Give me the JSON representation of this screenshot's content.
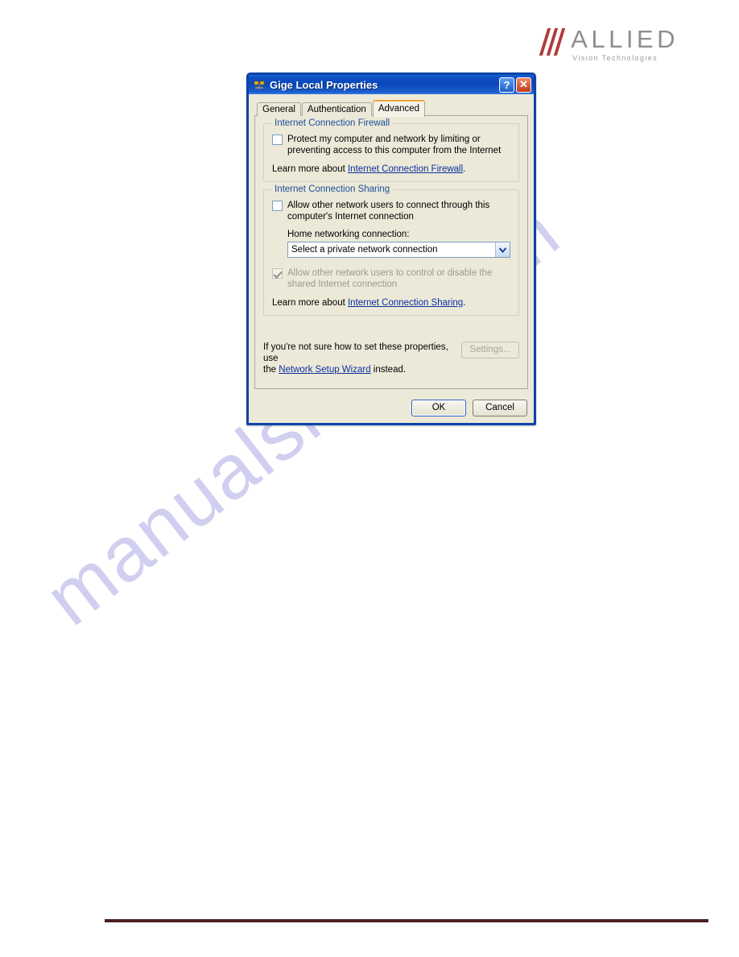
{
  "page": {
    "watermark": "manualshive.com",
    "logo": {
      "name": "ALLIED",
      "tagline": "Vision Technologies",
      "slash_color": "#b03a3a",
      "text_color": "#8d8d8d"
    },
    "footer_rule_color": "#4a1f1f"
  },
  "dialog": {
    "title": "Gige Local Properties",
    "titlebar_color": "#0a46b8",
    "help_button": "?",
    "close_button": "✕",
    "tabs": [
      {
        "label": "General",
        "active": false
      },
      {
        "label": "Authentication",
        "active": false
      },
      {
        "label": "Advanced",
        "active": true
      }
    ],
    "active_tab_accent": "#f2a33c",
    "firewall_group": {
      "title": "Internet Connection Firewall",
      "checkbox_label": "Protect my computer and network by limiting or preventing access to this computer from the Internet",
      "checked": false,
      "learn_more_prefix": "Learn more about ",
      "learn_more_link": "Internet Connection Firewall",
      "learn_more_suffix": "."
    },
    "sharing_group": {
      "title": "Internet Connection Sharing",
      "allow_connect_label": "Allow other network users to connect through this computer's Internet connection",
      "allow_connect_checked": false,
      "home_networking_label": "Home networking connection:",
      "home_networking_value": "Select a private network connection",
      "allow_control_label": "Allow other network users to control or disable the shared Internet connection",
      "allow_control_checked": true,
      "allow_control_disabled": true,
      "learn_more_prefix": "Learn more about ",
      "learn_more_link": "Internet Connection Sharing",
      "learn_more_suffix": "."
    },
    "hint": {
      "line1": "If you're not sure how to set these properties, use",
      "line2_prefix": "the ",
      "line2_link": "Network Setup Wizard",
      "line2_suffix": " instead."
    },
    "settings_button": "Settings...",
    "settings_disabled": true,
    "ok_button": "OK",
    "cancel_button": "Cancel"
  }
}
